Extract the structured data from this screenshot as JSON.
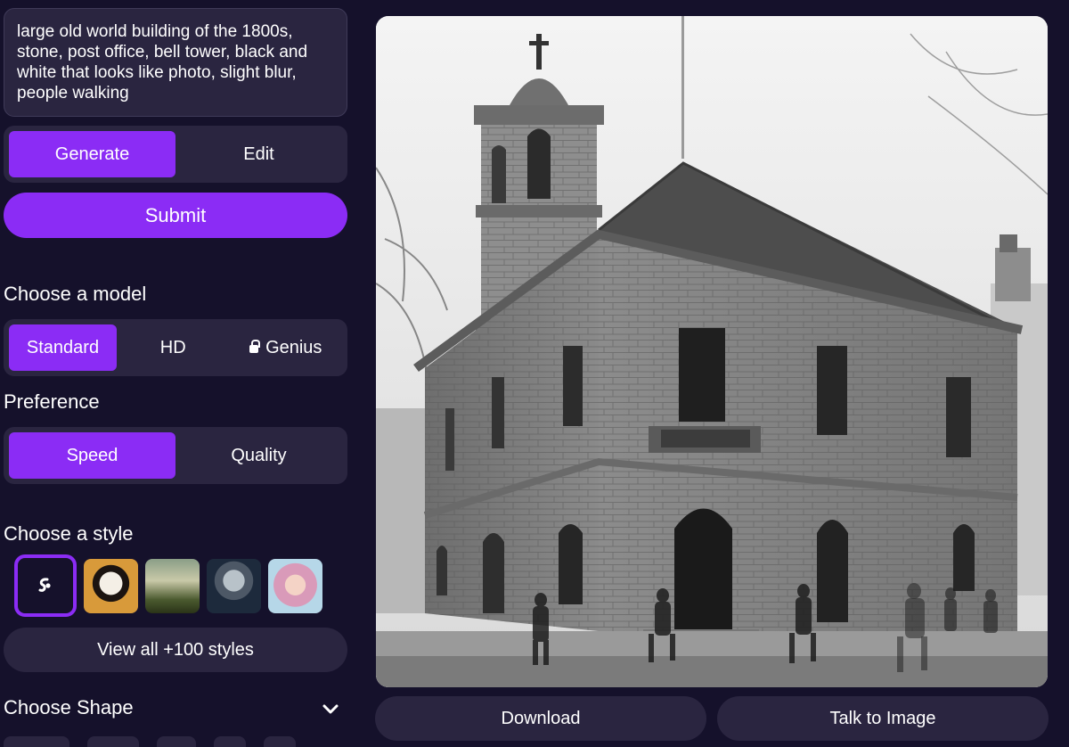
{
  "prompt": {
    "value": "large old world building of the 1800s, stone, post office, bell tower, black and white that looks like photo, slight blur, people walking"
  },
  "mode": {
    "options": [
      "Generate",
      "Edit"
    ],
    "selected": "Generate"
  },
  "submit_label": "Submit",
  "model": {
    "heading": "Choose a model",
    "options": [
      "Standard",
      "HD",
      "Genius"
    ],
    "selected": "Standard",
    "locked_icon": "lock-icon"
  },
  "preference": {
    "heading": "Preference",
    "options": [
      "Speed",
      "Quality"
    ],
    "selected": "Speed"
  },
  "style": {
    "heading": "Choose a style",
    "thumbnails": [
      "no-style",
      "panda",
      "forest",
      "robot",
      "anime-girl"
    ],
    "selected": "no-style",
    "view_all_label": "View all +100 styles"
  },
  "shape": {
    "heading": "Choose Shape"
  },
  "actions": {
    "download_label": "Download",
    "talk_label": "Talk to Image"
  },
  "colors": {
    "background": "#15112b",
    "panel": "#2a2540",
    "accent": "#8b2cf5"
  }
}
